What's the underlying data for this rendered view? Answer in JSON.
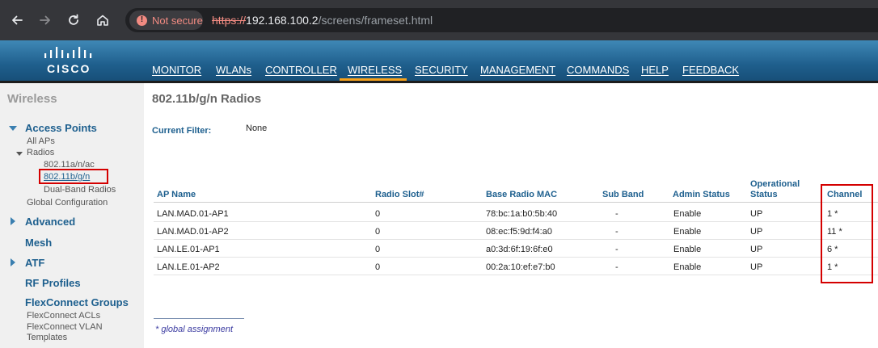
{
  "browser": {
    "security_label": "Not secure",
    "url_scheme": "https://",
    "url_host": "192.168.100.2",
    "url_path": "/screens/frameset.html"
  },
  "brand": {
    "logo_text": "CISCO"
  },
  "menu": [
    "MONITOR",
    "WLANs",
    "CONTROLLER",
    "WIRELESS",
    "SECURITY",
    "MANAGEMENT",
    "COMMANDS",
    "HELP",
    "FEEDBACK"
  ],
  "menu_active": "WIRELESS",
  "sidebar": {
    "title": "Wireless",
    "access_points": "Access Points",
    "all_aps": "All APs",
    "radios": "Radios",
    "radio_80211a": "802.11a/n/ac",
    "radio_80211b": "802.11b/g/n",
    "dual_band": "Dual-Band Radios",
    "global_config": "Global Configuration",
    "advanced": "Advanced",
    "mesh": "Mesh",
    "atf": "ATF",
    "rf_profiles": "RF Profiles",
    "flexconnect_groups": "FlexConnect Groups",
    "flexconnect_acls": "FlexConnect ACLs",
    "flexconnect_vlan_1": "FlexConnect VLAN",
    "flexconnect_vlan_2": "Templates"
  },
  "page": {
    "title": "802.11b/g/n Radios",
    "filter_label": "Current Filter:",
    "filter_value": "None",
    "footnote": "* global assignment"
  },
  "table": {
    "headers": {
      "ap_name": "AP Name",
      "radio_slot": "Radio Slot#",
      "base_mac": "Base Radio MAC",
      "sub_band": "Sub Band",
      "admin_status": "Admin Status",
      "oper_status_1": "Operational",
      "oper_status_2": "Status",
      "channel": "Channel"
    },
    "rows": [
      {
        "ap_name": "LAN.MAD.01-AP1",
        "slot": "0",
        "mac": "78:bc:1a:b0:5b:40",
        "sub_band": "-",
        "admin": "Enable",
        "oper": "UP",
        "channel": "1 *"
      },
      {
        "ap_name": "LAN.MAD.01-AP2",
        "slot": "0",
        "mac": "08:ec:f5:9d:f4:a0",
        "sub_band": "-",
        "admin": "Enable",
        "oper": "UP",
        "channel": "11 *"
      },
      {
        "ap_name": "LAN.LE.01-AP1",
        "slot": "0",
        "mac": "a0:3d:6f:19:6f:e0",
        "sub_band": "-",
        "admin": "Enable",
        "oper": "UP",
        "channel": "6 *"
      },
      {
        "ap_name": "LAN.LE.01-AP2",
        "slot": "0",
        "mac": "00:2a:10:ef:e7:b0",
        "sub_band": "-",
        "admin": "Enable",
        "oper": "UP",
        "channel": "1 *"
      }
    ]
  },
  "colors": {
    "accent": "#f7a21b",
    "header_blue": "#1f5f8e",
    "highlight_red": "#d40000"
  }
}
